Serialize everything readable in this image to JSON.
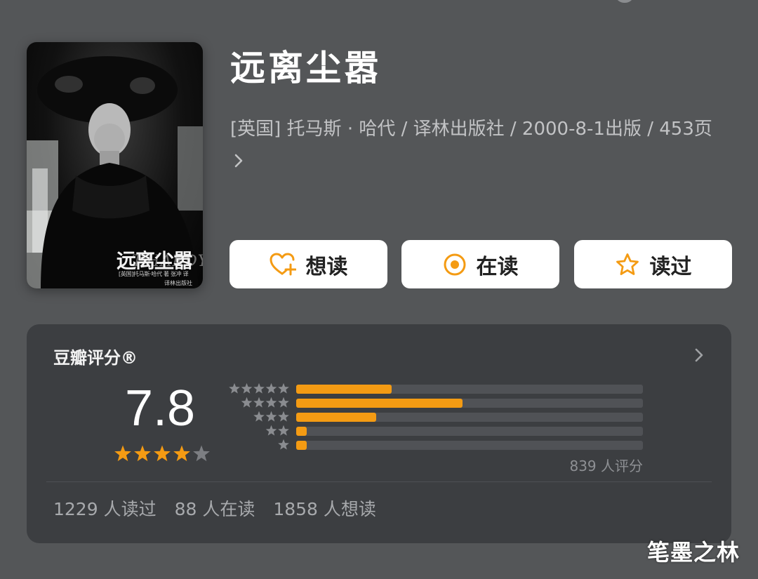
{
  "book": {
    "title": "远离尘嚣",
    "meta": "[英国] 托马斯 · 哈代 / 译林出版社 / 2000-8-1出版 / 453页",
    "meta_chevron_icon": "chevron-right-icon",
    "cover": {
      "script_text": "T.HARDY",
      "title_text": "远离尘嚣",
      "author_line": "[英国]托马斯·哈代 著 张冲 译",
      "publisher_line": "译林出版社"
    }
  },
  "actions": [
    {
      "label": "想读",
      "icon": "heart-plus-icon"
    },
    {
      "label": "在读",
      "icon": "target-circle-icon"
    },
    {
      "label": "读过",
      "icon": "star-outline-icon"
    }
  ],
  "rating": {
    "heading": "豆瓣评分®",
    "score": "7.8",
    "score_stars": 4,
    "distribution_percent": [
      27.5,
      47.9,
      23.1,
      3.0,
      3.0
    ],
    "count_text": "839 人评分",
    "stats": {
      "read": "1229 人读过",
      "reading": "88 人在读",
      "want": "1858 人想读"
    }
  },
  "colors": {
    "background": "#545658",
    "card": "#3c3e41",
    "accent": "#f49b13",
    "star_empty": "#7c7e82"
  },
  "watermark": "笔墨之林"
}
